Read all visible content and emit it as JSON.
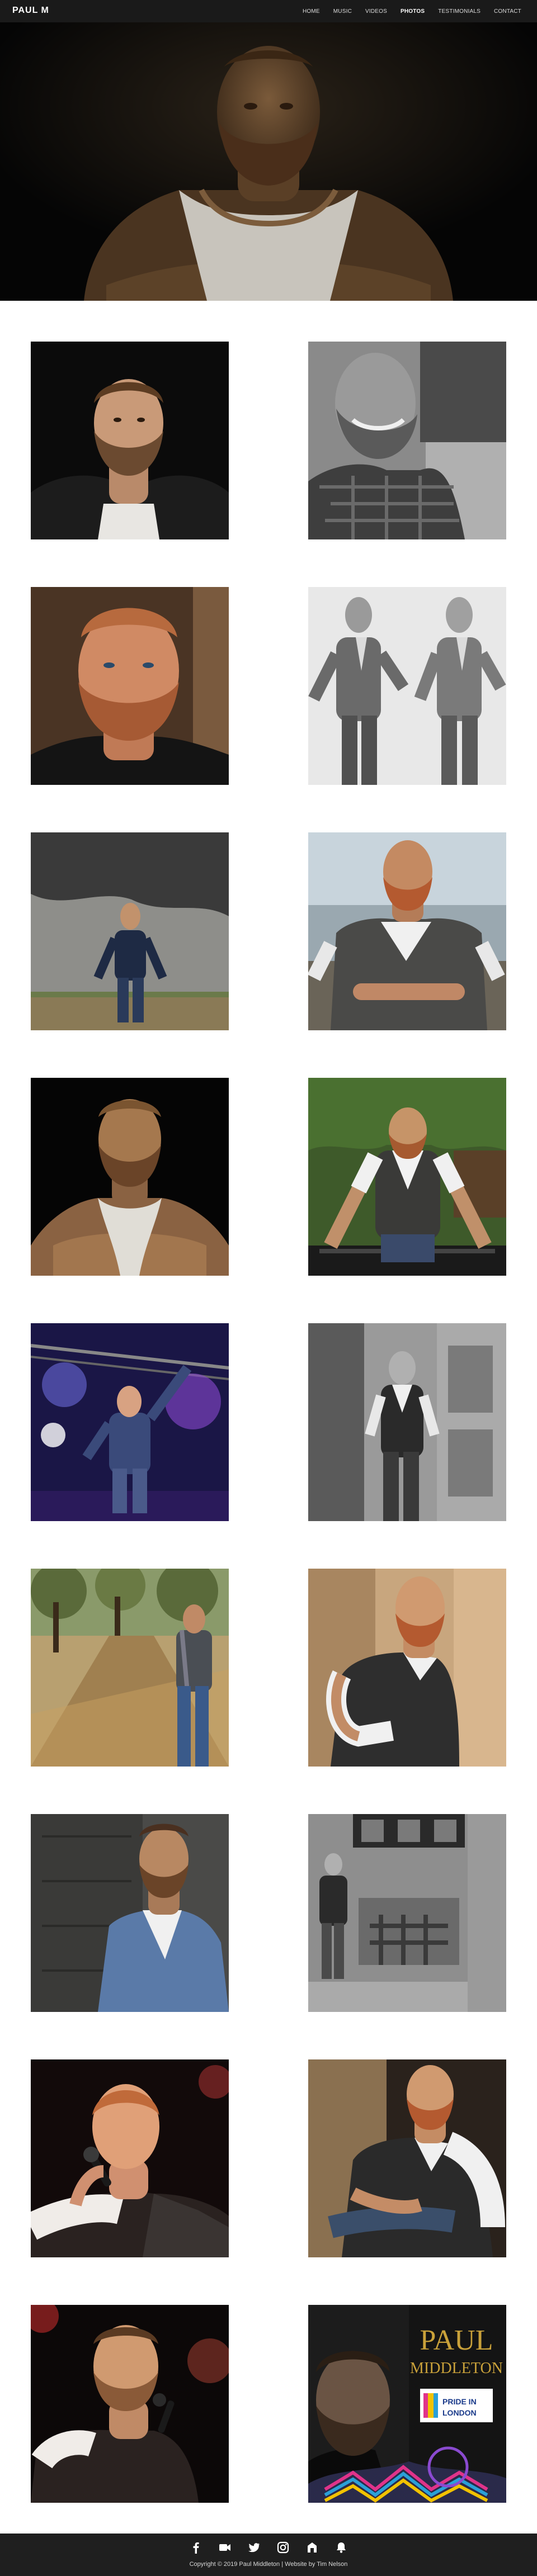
{
  "header": {
    "brand": "PAUL M",
    "menu": [
      {
        "label": "HOME"
      },
      {
        "label": "MUSIC"
      },
      {
        "label": "VIDEOS"
      },
      {
        "label": "PHOTOS"
      },
      {
        "label": "TESTIMONIALS"
      },
      {
        "label": "CONTACT"
      }
    ],
    "active_item": "PHOTOS"
  },
  "hero": {
    "description_icon": "portrait-photo-icon"
  },
  "gallery": {
    "photo_count": 18
  },
  "poster": {
    "name_line1": "PAUL",
    "name_line2": "MIDDLETON",
    "badge_top": "PRIDE IN",
    "badge_bottom": "LONDON"
  },
  "footer": {
    "social_icons": [
      "facebook-icon",
      "video-icon",
      "twitter-icon",
      "instagram-icon",
      "store-icon",
      "notification-icon"
    ],
    "copyright": "Copyright © 2019 Paul Middleton | Website by Tim Nelson"
  },
  "colors": {
    "nav_bg": "#1a1a1a",
    "footer_bg": "#1f1f1f",
    "poster_gold": "#c9a13a"
  }
}
